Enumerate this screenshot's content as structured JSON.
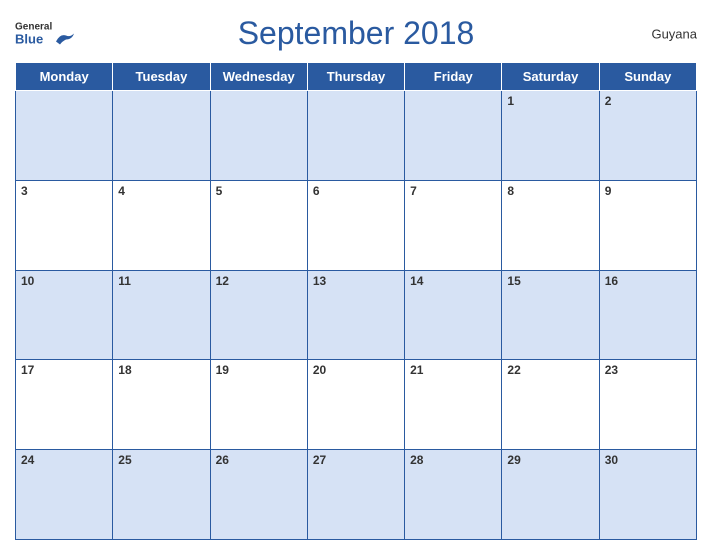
{
  "header": {
    "title": "September 2018",
    "country": "Guyana",
    "logo": {
      "general": "General",
      "blue": "Blue"
    }
  },
  "days": [
    "Monday",
    "Tuesday",
    "Wednesday",
    "Thursday",
    "Friday",
    "Saturday",
    "Sunday"
  ],
  "weeks": [
    [
      null,
      null,
      null,
      null,
      null,
      1,
      2
    ],
    [
      3,
      4,
      5,
      6,
      7,
      8,
      9
    ],
    [
      10,
      11,
      12,
      13,
      14,
      15,
      16
    ],
    [
      17,
      18,
      19,
      20,
      21,
      22,
      23
    ],
    [
      24,
      25,
      26,
      27,
      28,
      29,
      30
    ]
  ],
  "colors": {
    "header_bg": "#2a5aa0",
    "row_blue": "#d6e2f5",
    "row_white": "#ffffff"
  }
}
